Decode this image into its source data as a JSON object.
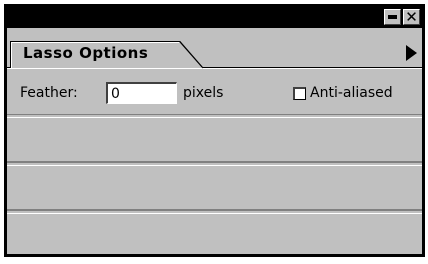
{
  "palette": {
    "tab_label": "Lasso Options",
    "minimize_icon": "minimize-icon",
    "close_icon": "close-icon",
    "close_glyph": "✕",
    "menu_icon": "triangle-right-icon"
  },
  "options": {
    "feather_label": "Feather:",
    "feather_value": "0",
    "units_label": "pixels",
    "anti_aliased_label": "Anti-aliased",
    "anti_aliased_checked": false
  },
  "colors": {
    "panel_background": "#c0c0c0",
    "title_bar": "#000000"
  }
}
